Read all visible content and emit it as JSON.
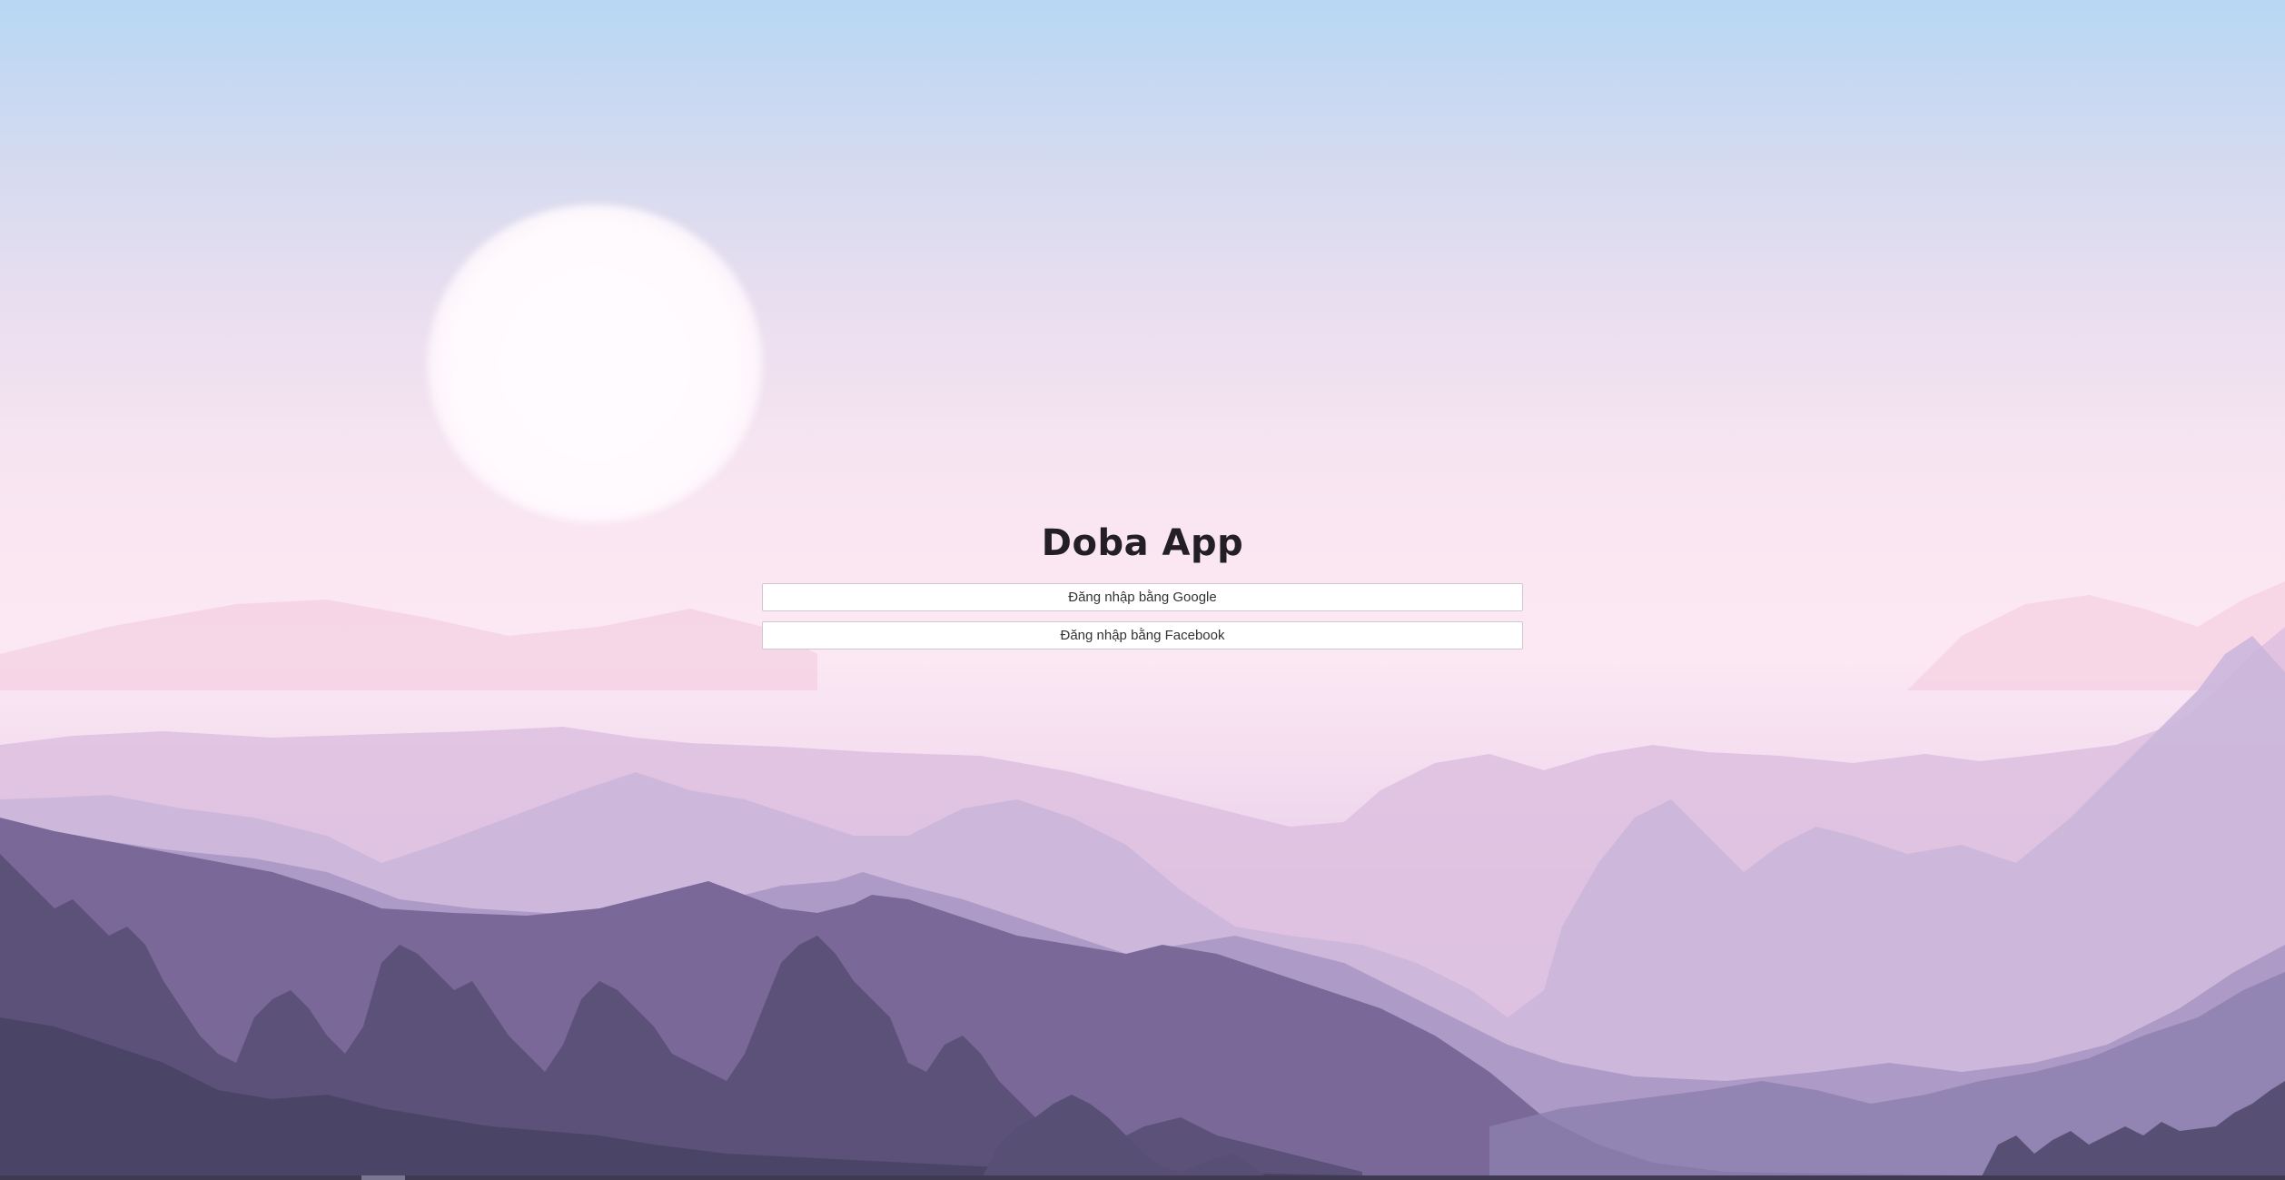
{
  "app": {
    "title": "Doba App"
  },
  "login": {
    "google_label": "Đăng nhập bằng Google",
    "facebook_label": "Đăng nhập bằng Facebook"
  },
  "colors": {
    "title_text": "#231f24",
    "button_bg": "#ffffff",
    "button_border": "#cfc8d0",
    "sky_top": "#b7d7f3",
    "mountain_dark": "#4a4566"
  }
}
